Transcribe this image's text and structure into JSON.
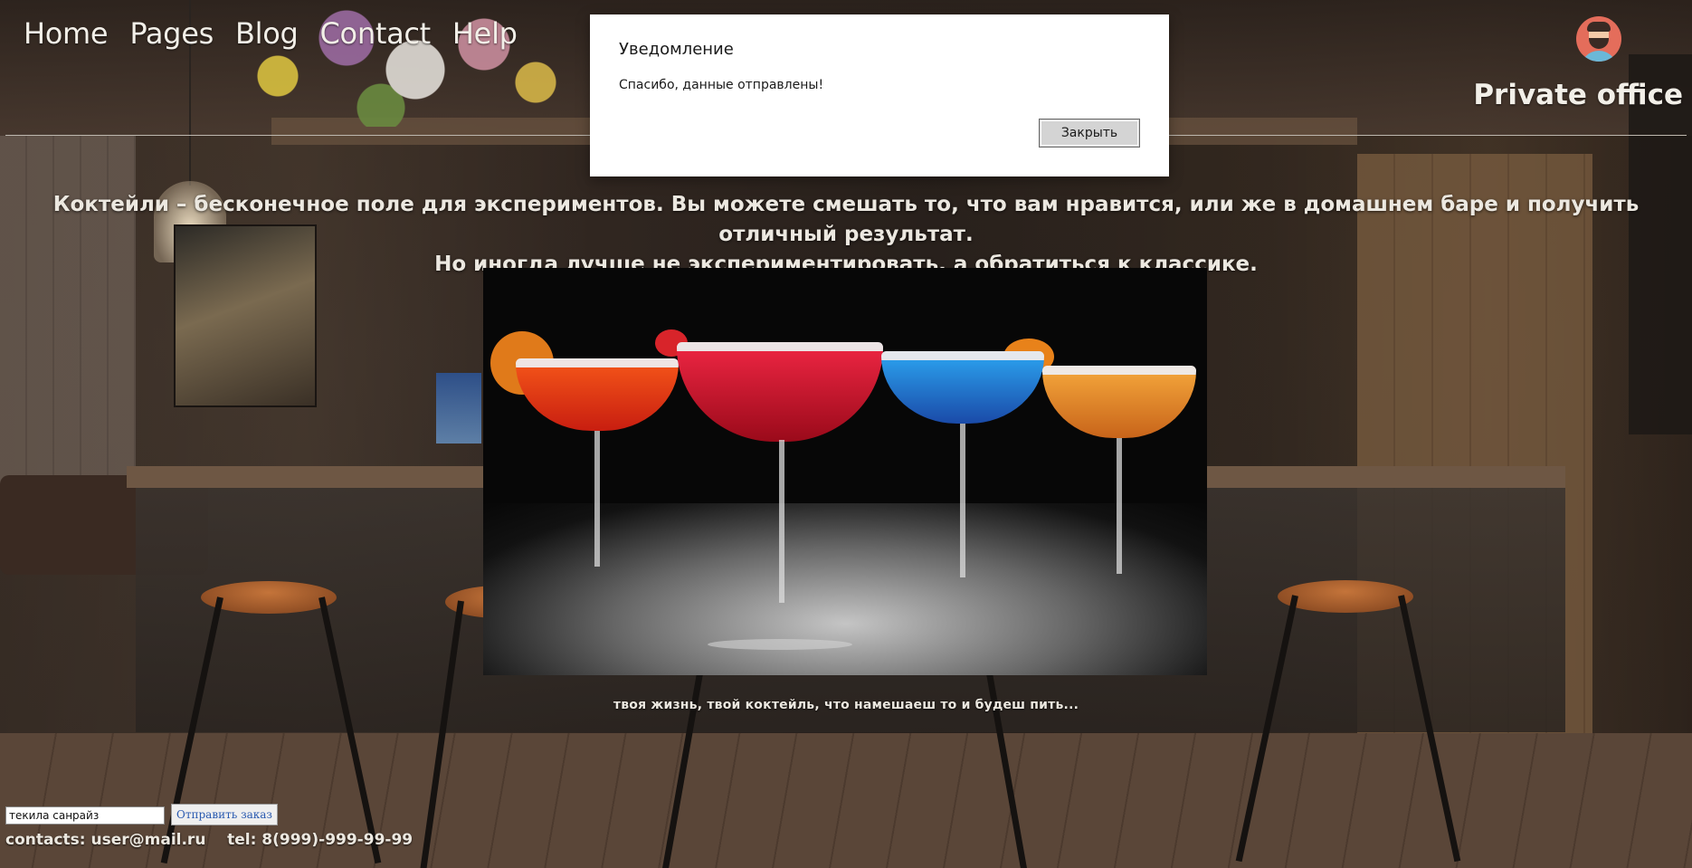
{
  "nav": {
    "items": [
      {
        "label": "Home"
      },
      {
        "label": "Pages"
      },
      {
        "label": "Blog"
      },
      {
        "label": "Contact"
      },
      {
        "label": "Help"
      }
    ]
  },
  "header": {
    "office_label": "Private office",
    "avatar_icon": "user-avatar-icon"
  },
  "main": {
    "intro_line1": "Коктейли – бесконечное поле для экспериментов. Вы можете смешать то, что вам нравится, или же в домашнем баре и получить отличный результат.",
    "intro_line2": "Но иногда лучше не экспериментировать, а обратиться к классике.",
    "caption": "твоя жизнь, твой коктейль, что намешаеш то и будеш пить..."
  },
  "order": {
    "input_value": "текила санрайз",
    "submit_label": "Отправить заказ"
  },
  "footer": {
    "contacts": "contacts: user@mail.ru    tel: 8(999)-999-99-99"
  },
  "modal": {
    "title": "Уведомление",
    "message": "Спасибо, данные отправлены!",
    "close_label": "Закрыть"
  }
}
